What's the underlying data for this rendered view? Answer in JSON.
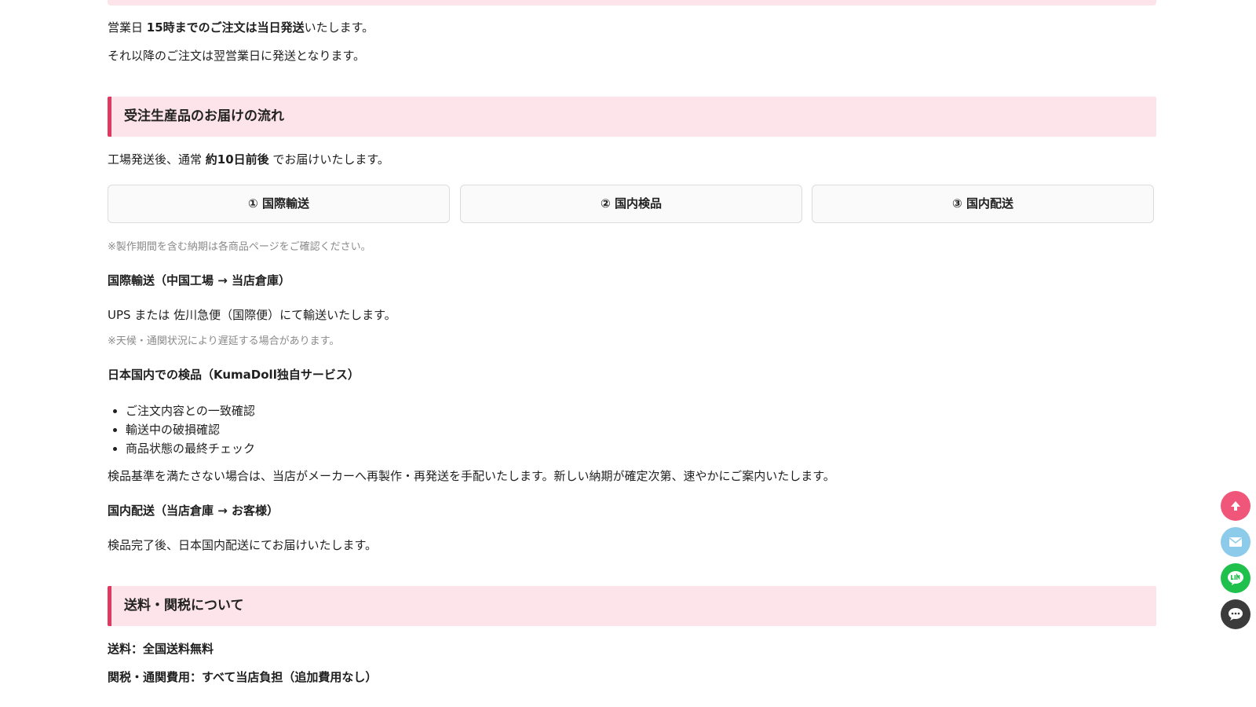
{
  "shipping": {
    "line1_pre": "営業日 ",
    "line1_bold": "15時までのご注文は当日発送",
    "line1_post": "いたします。",
    "line2": "それ以降のご注文は翌営業日に発送となります。"
  },
  "flow": {
    "heading": "受注生産品のお届けの流れ",
    "intro_pre": "工場発送後、通常 ",
    "intro_bold": "約10日前後",
    "intro_post": " でお届けいたします。",
    "steps": [
      "① 国際輸送",
      "② 国内検品",
      "③ 国内配送"
    ],
    "note": "※製作期間を含む納期は各商品ページをご確認ください。",
    "intl_title": "国際輸送（中国工場 → 当店倉庫）",
    "intl_text": "UPS または 佐川急便（国際便）にて輸送いたします。",
    "intl_note": "※天候・通関状況により遅延する場合があります。",
    "inspect_title": "日本国内での検品（KumaDoll独自サービス）",
    "inspect_items": [
      "ご注文内容との一致確認",
      "輸送中の破損確認",
      "商品状態の最終チェック"
    ],
    "inspect_text": "検品基準を満たさない場合は、当店がメーカーへ再製作・再発送を手配いたします。新しい納期が確定次第、速やかにご案内いたします。",
    "domestic_title": "国内配送（当店倉庫 → お客様）",
    "domestic_text": "検品完了後、日本国内配送にてお届けいたします。"
  },
  "fees": {
    "heading": "送料・関税について",
    "shipping_fee": "送料：全国送料無料",
    "duties": "関税・通関費用：すべて当店負担（追加費用なし）"
  },
  "floating_buttons": [
    {
      "name": "scroll-top",
      "icon": "arrow-up-icon",
      "color": "#f0557a"
    },
    {
      "name": "mail",
      "icon": "mail-icon",
      "color": "#8ccbea"
    },
    {
      "name": "line",
      "icon": "line-icon",
      "color": "#1fc14c"
    },
    {
      "name": "chat",
      "icon": "chat-icon",
      "color": "#3b3b3b"
    }
  ],
  "colors": {
    "accent": "#e2375f",
    "heading_bg": "#fde4ea"
  }
}
